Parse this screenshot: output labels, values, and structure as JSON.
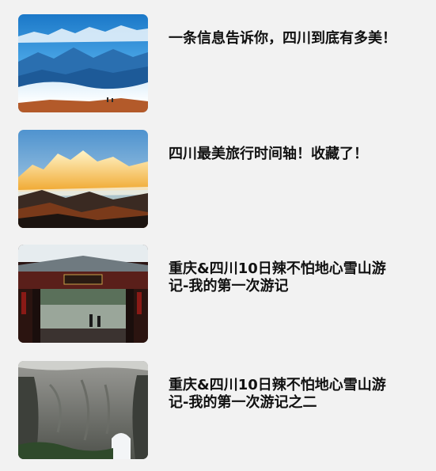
{
  "articles": [
    {
      "title": "一条信息告诉你，四川到底有多美！",
      "thumbnail_icon": "mountain-sea-of-clouds-image"
    },
    {
      "title": "四川最美旅行时间轴！收藏了！",
      "thumbnail_icon": "golden-snow-peak-image"
    },
    {
      "title": "重庆&四川10日辣不怕地心雪山游记-我的第一次游记",
      "thumbnail_icon": "ancient-gate-image"
    },
    {
      "title": "重庆&四川10日辣不怕地心雪山游记-我的第一次游记之二",
      "thumbnail_icon": "karst-cave-image"
    }
  ]
}
